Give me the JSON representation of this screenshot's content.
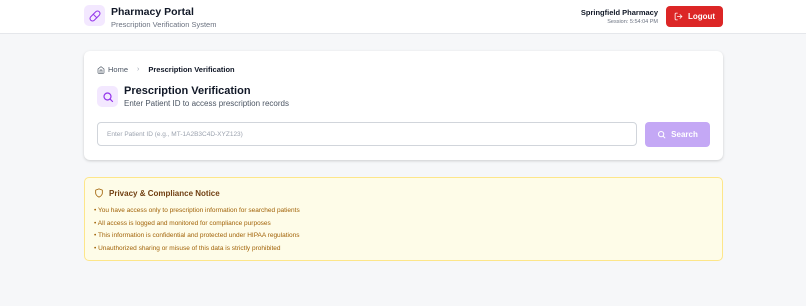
{
  "header": {
    "app_title": "Pharmacy Portal",
    "app_subtitle": "Prescription Verification System",
    "pharmacy_name": "Springfield Pharmacy",
    "session": "Session: 5:54:04 PM",
    "logout_label": "Logout",
    "logo_icon": "pill-icon",
    "logout_icon": "logout-icon"
  },
  "breadcrumb": {
    "home": "Home",
    "current": "Prescription Verification"
  },
  "verification": {
    "title": "Prescription Verification",
    "subtitle": "Enter Patient ID to access prescription records",
    "input_placeholder": "Enter Patient ID (e.g., MT-1A2B3C4D-XYZ123)",
    "input_value": "",
    "search_label": "Search"
  },
  "notice": {
    "title": "Privacy & Compliance Notice",
    "items": [
      "You have access only to prescription information for searched patients",
      "All access is logged and monitored for compliance purposes",
      "This information is confidential and protected under HIPAA regulations",
      "Unauthorized sharing or misuse of this data is strictly prohibited"
    ]
  },
  "colors": {
    "accent": "#9333ea",
    "accent_light": "#f3e8ff",
    "logout": "#dc2626",
    "search_button": "#c4a8f5",
    "notice_bg": "#fefce8",
    "notice_text": "#a16207"
  }
}
